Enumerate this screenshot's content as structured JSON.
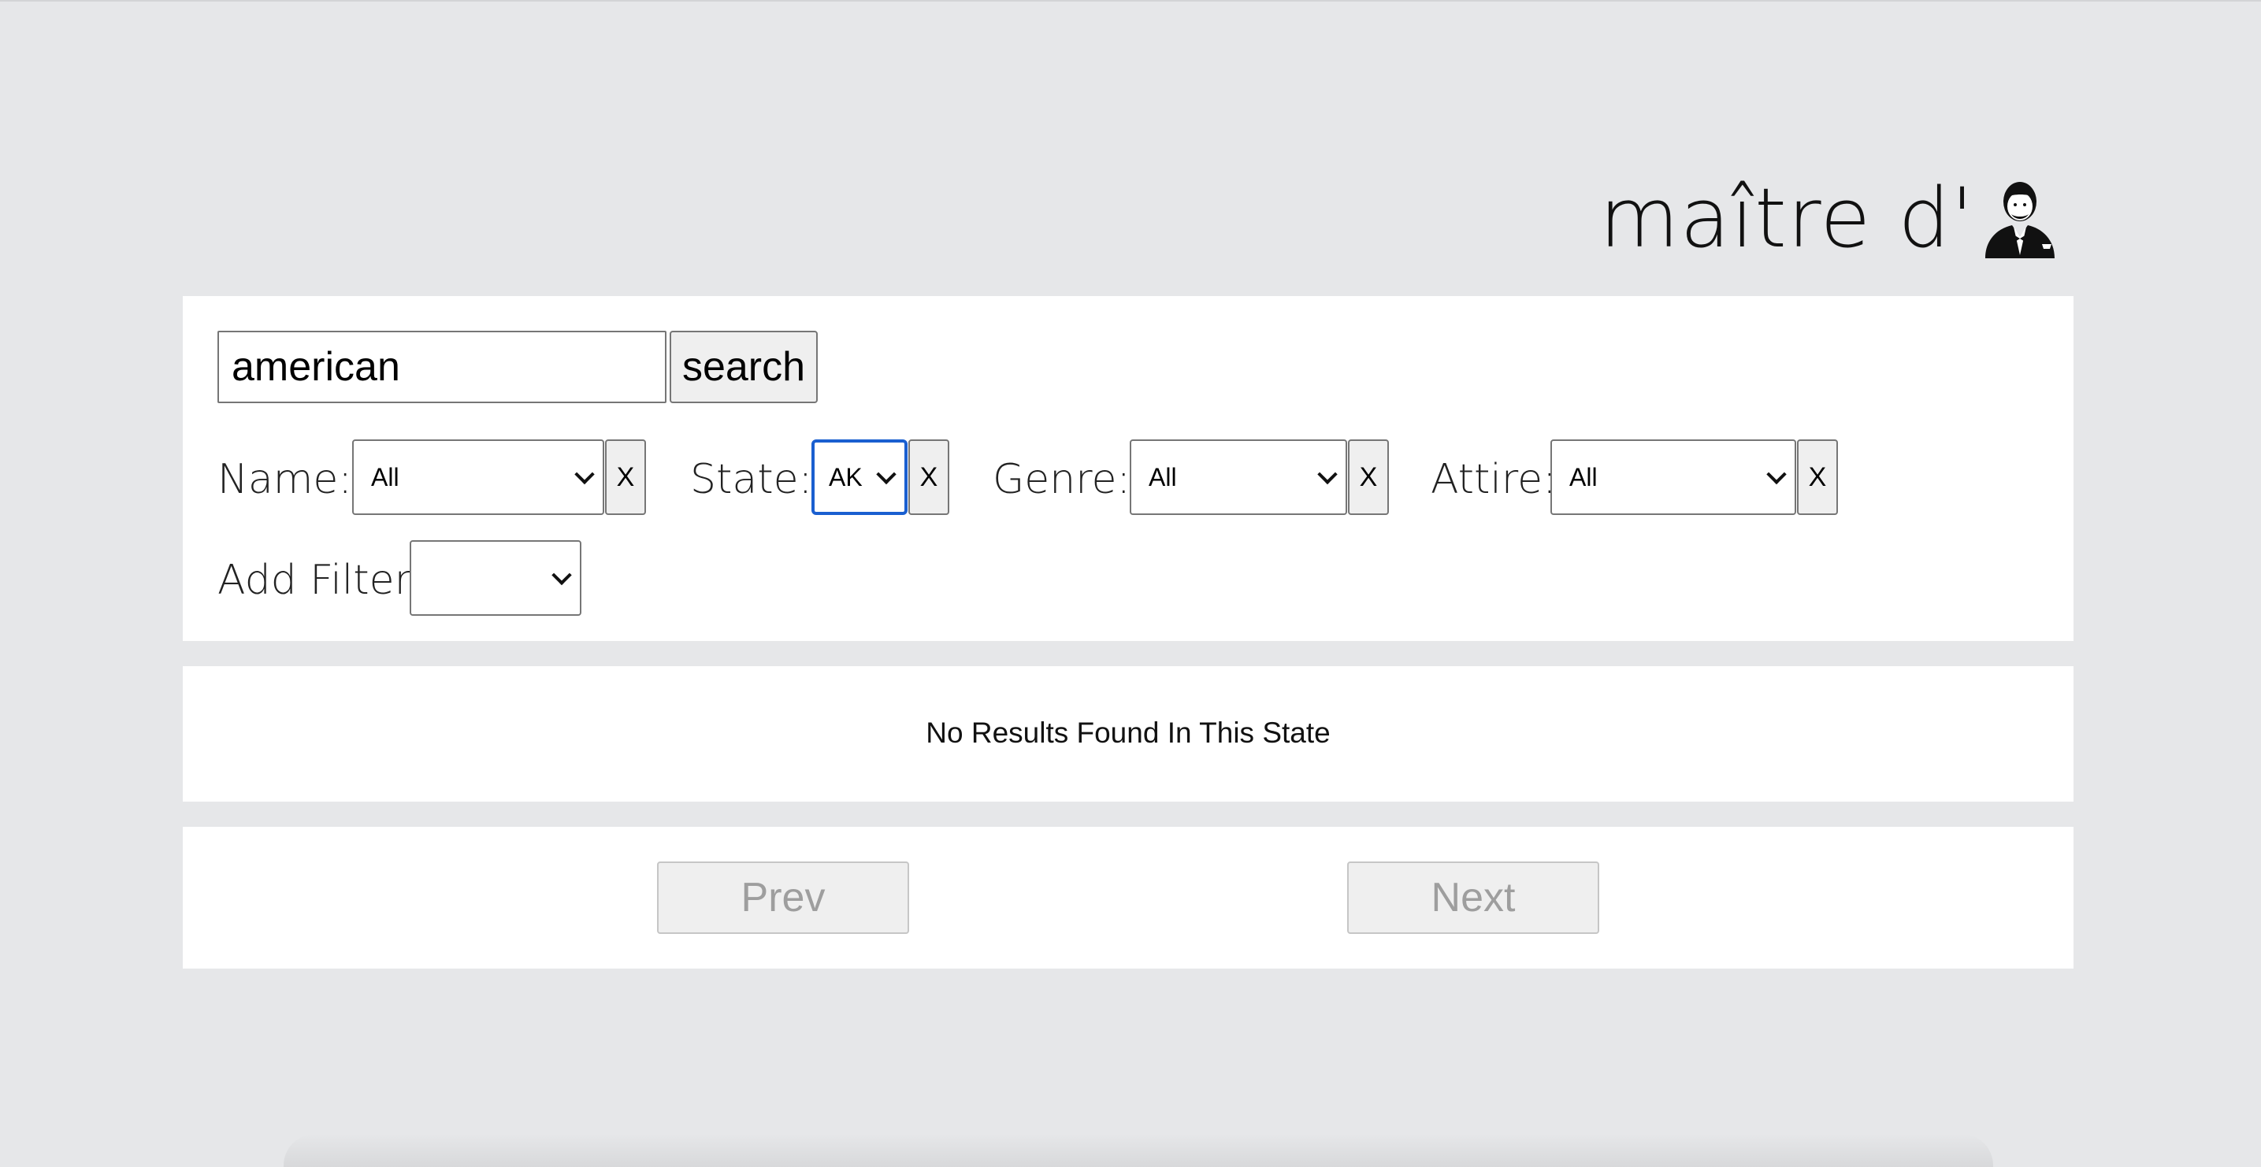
{
  "header": {
    "title": "maître d'",
    "logo_icon": "waiter-icon"
  },
  "search": {
    "value": "american",
    "button_label": "search"
  },
  "filters": [
    {
      "label": "Name:",
      "selected": "All",
      "clear_label": "X"
    },
    {
      "label": "State:",
      "selected": "AK",
      "clear_label": "X"
    },
    {
      "label": "Genre:",
      "selected": "All",
      "clear_label": "X"
    },
    {
      "label": "Attire:",
      "selected": "All",
      "clear_label": "X"
    }
  ],
  "add_filter": {
    "label": "Add Filter:",
    "selected": ""
  },
  "results": {
    "message": "No Results Found In This State"
  },
  "pager": {
    "prev_label": "Prev",
    "next_label": "Next"
  },
  "colors": {
    "background": "#e6e7e9",
    "panel": "#ffffff",
    "focus_ring": "#1a5fd0",
    "disabled_text": "#9e9e9e"
  }
}
